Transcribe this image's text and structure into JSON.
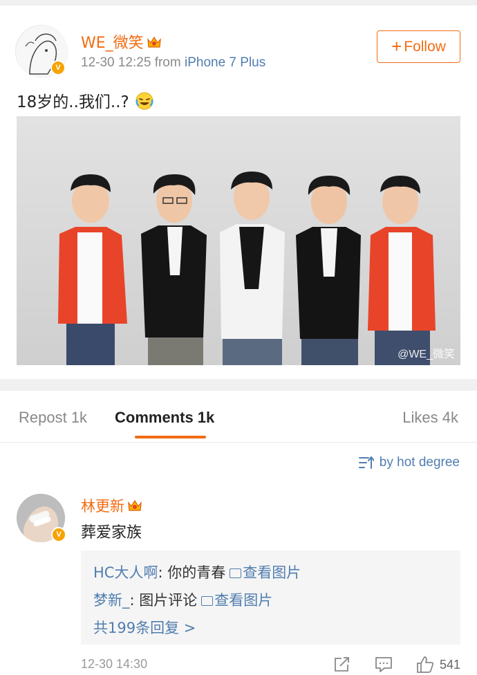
{
  "post": {
    "author": "WE_微笑",
    "time": "12-30 12:25",
    "source_prefix": "from",
    "source": "iPhone 7 Plus",
    "follow_label": "Follow",
    "text": "18岁的..我们..?",
    "watermark": "@WE_微笑"
  },
  "tabs": {
    "repost": "Repost 1k",
    "comments": "Comments 1k",
    "likes": "Likes 4k"
  },
  "sort_label": "by hot degree",
  "comment": {
    "author": "林更新",
    "text": "葬爱家族",
    "replies": [
      {
        "who": "HC大人啊",
        "text": ": 你的青春",
        "link": "查看图片"
      },
      {
        "who": "梦新_",
        "text": ": 图片评论",
        "link": "查看图片"
      }
    ],
    "more": "共199条回复 >",
    "time": "12-30 14:30",
    "like_count": "541"
  },
  "colors": {
    "accent": "#f26b12",
    "link": "#507daf",
    "verified": "#f7a300"
  }
}
